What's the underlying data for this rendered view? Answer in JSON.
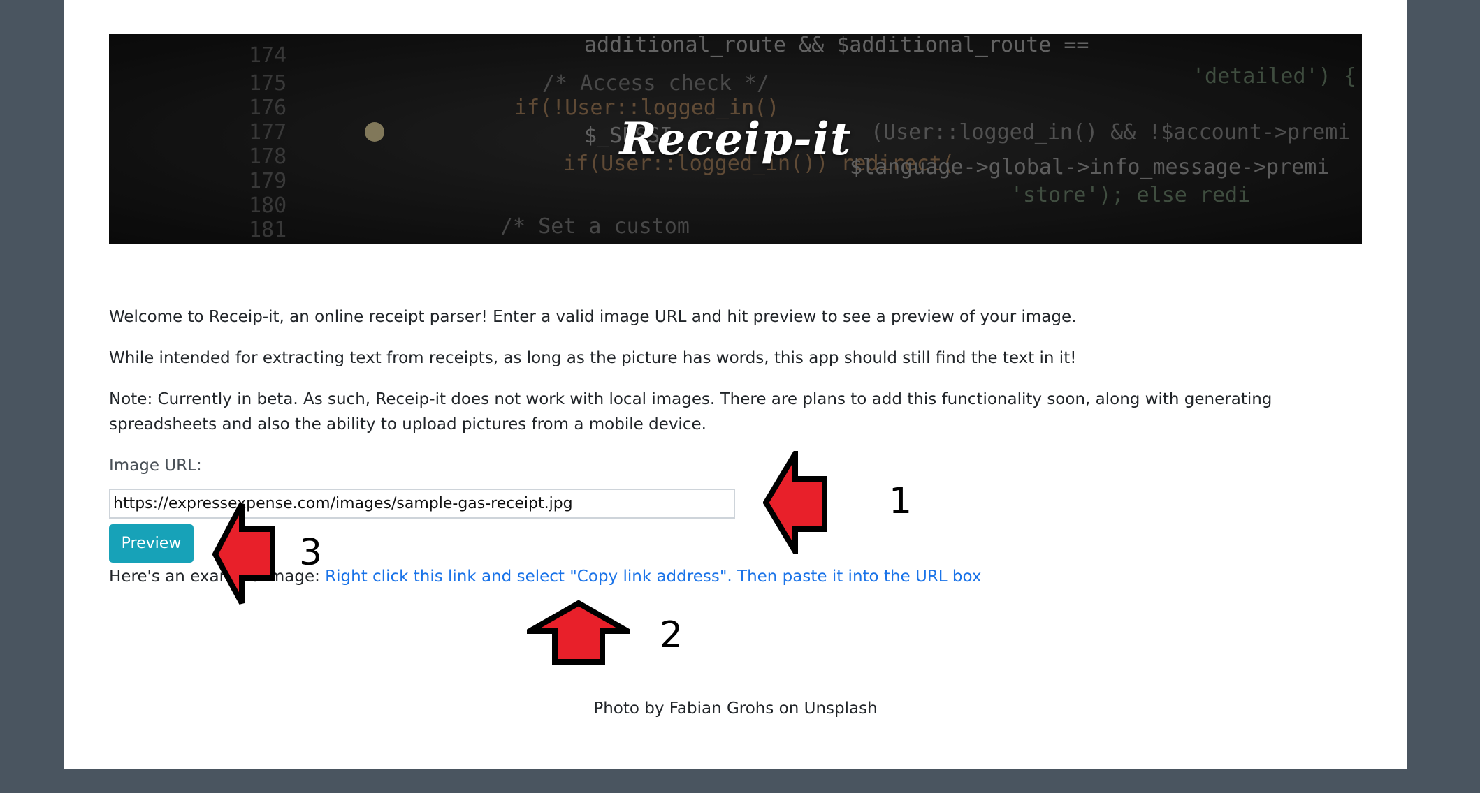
{
  "header": {
    "title": "Receip-it"
  },
  "intro": {
    "welcome": "Welcome to Receip-it, an online receipt parser! Enter a valid image URL and hit preview to see a preview of your image.",
    "purpose": "While intended for extracting text from receipts, as long as the picture has words, this app should still find the text in it!",
    "note": "Note: Currently in beta. As such, Receip-it does not work with local images. There are plans to add this functionality soon, along with generating spreadsheets and also the ability to upload pictures from a mobile device."
  },
  "form": {
    "url_label": "Image URL:",
    "url_value": "https://expressexpense.com/images/sample-gas-receipt.jpg",
    "preview_label": "Preview"
  },
  "example": {
    "prefix": "Here's an example image: ",
    "link_text": "Right click this link and select \"Copy link address\". Then paste it into the URL box"
  },
  "footer": {
    "credit": "Photo by Fabian Grohs on Unsplash"
  },
  "annotations": {
    "arrow_1_number": "1",
    "arrow_2_number": "2",
    "arrow_3_number": "3",
    "arrow_color": "#e8202a"
  },
  "colors": {
    "page_background": "#4a5560",
    "button_accent": "#17a2b8",
    "link": "#1a73e8"
  }
}
